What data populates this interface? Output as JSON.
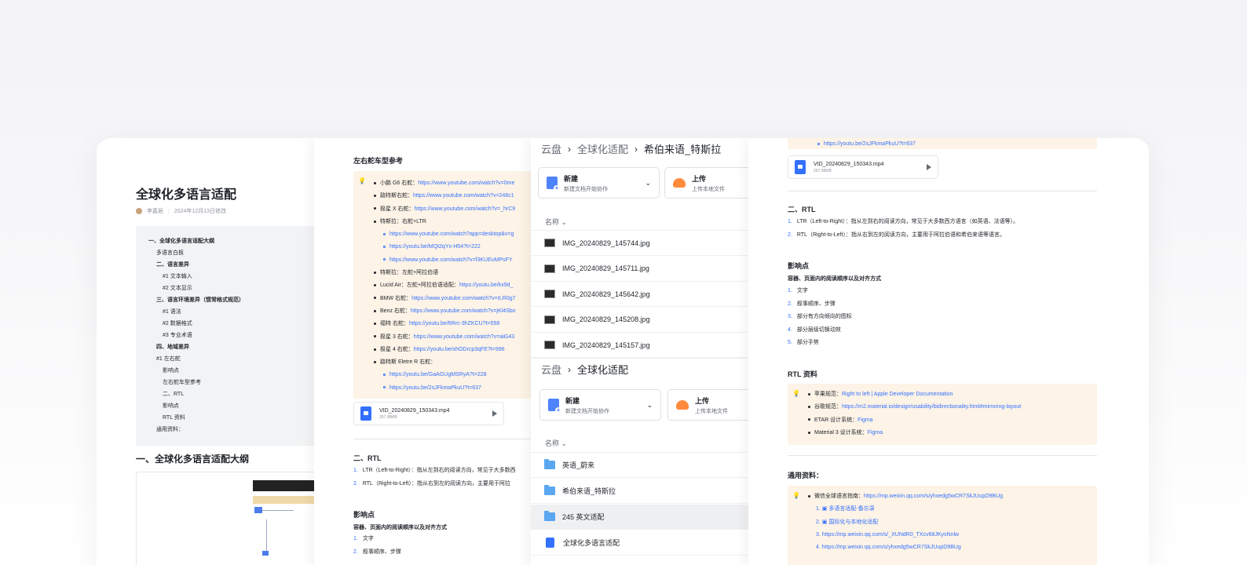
{
  "colors": {
    "accent": "#3370ff",
    "callout_bg": "#fdf3e6",
    "folder": "#5aa7f0"
  },
  "panel1": {
    "title": "全球化多语言适配",
    "author": "李嘉辰",
    "modified": "2024年12月13日修改",
    "outline": [
      {
        "text": "一、全球化多语言适配大纲",
        "level": 1,
        "bold": true
      },
      {
        "text": "多语言白板",
        "level": 2
      },
      {
        "text": "二、语言差异",
        "level": 2,
        "bold": true
      },
      {
        "text": "#1 文本输入",
        "level": 3
      },
      {
        "text": "#2 文本显示",
        "level": 3
      },
      {
        "text": "三、语言环境差异（惯常格式规范）",
        "level": 2,
        "bold": true
      },
      {
        "text": "#1 语法",
        "level": 3
      },
      {
        "text": "#2 数据格式",
        "level": 3
      },
      {
        "text": "#3 专业术语",
        "level": 3
      },
      {
        "text": "四、地域差异",
        "level": 2,
        "bold": true
      },
      {
        "text": "#1 左右舵",
        "level": 2
      },
      {
        "text": "影响点",
        "level": 3
      },
      {
        "text": "左右舵车型参考",
        "level": 3
      },
      {
        "text": "二、RTL",
        "level": 3
      },
      {
        "text": "影响点",
        "level": 3
      },
      {
        "text": "RTL 资料",
        "level": 3
      },
      {
        "text": "通用资料：",
        "level": 2
      }
    ],
    "heading": "一、全球化多语言适配大纲"
  },
  "panel2": {
    "section_title": "左右舵车型参考",
    "callout_items": [
      {
        "label": "小鹏 G6 右舵：",
        "link": "https://www.youtube.com/watch?v=0me",
        "level": 1
      },
      {
        "label": "路特斯右舵：",
        "link": "https://www.youtube.com/watch?v=248c1",
        "level": 1
      },
      {
        "label": "极星 X 右舵：",
        "link": "https://www.youtube.com/watch?v=_hrC9",
        "level": 1
      },
      {
        "label": "特斯拉：右舵+LTR",
        "link": "",
        "level": 1
      },
      {
        "label": "",
        "link": "https://www.youtube.com/watch?app=desktop&v=g",
        "level": 2
      },
      {
        "label": "",
        "link": "https://youtu.be/MQt2qYx-H54?t=222",
        "level": 2
      },
      {
        "label": "",
        "link": "https://www.youtube.com/watch?v=f3KUEuMPsFY",
        "level": 2
      },
      {
        "label": "特斯拉：左舵+阿拉伯语",
        "link": "",
        "level": 1
      },
      {
        "label": "Lucid Air：左舵+阿拉伯语适配：",
        "link": "https://youtu.be/kx9d_",
        "level": 1
      },
      {
        "label": "BMW 右舵：",
        "link": "https://www.youtube.com/watch?v=rLR0g7",
        "level": 1
      },
      {
        "label": "Benz 右舵：",
        "link": "https://www.youtube.com/watch?v=jKl4Sbo",
        "level": 1
      },
      {
        "label": "福特 右舵：",
        "link": "https://youtu.be/6Rrc-3hZKCU?t=558",
        "level": 1
      },
      {
        "label": "极星 3 右舵：",
        "link": "https://www.youtube.com/watch?v=aiG43",
        "level": 1
      },
      {
        "label": "极星 4 右舵：",
        "link": "https://youtu.be/xhODrcp3qFE?t=996",
        "level": 1
      },
      {
        "label": "路特斯 Eletre R 右舵：",
        "link": "",
        "level": 1
      },
      {
        "label": "",
        "link": "https://youtu.be/GaAGUgMSRyA?t=228",
        "level": 2
      },
      {
        "label": "",
        "link": "https://youtu.be/2sJFkmaPkuU?t=637",
        "level": 2
      }
    ],
    "file": {
      "name": "VID_20240829_150343.mp4",
      "size": "267.98MB"
    },
    "rtl_heading": "二、RTL",
    "rtl_items": [
      {
        "n": "1.",
        "text": "LTR（Left-to-Right）：指从左到右的阅读方向，常见于大多数西"
      },
      {
        "n": "2.",
        "text": "RTL（Right-to-Left）：指从右到左的阅读方向，主要用于阿拉"
      }
    ],
    "impact_heading": "影响点",
    "impact_sub": "容器、页面内的阅读顺序以及对齐方式",
    "impact_items": [
      {
        "n": "1.",
        "text": "文字"
      },
      {
        "n": "2.",
        "text": "叙事顺序、步骤"
      }
    ]
  },
  "panel3": {
    "crumbs_top": [
      "云盘",
      "全球化适配",
      "希伯来语_特斯拉"
    ],
    "crumbs_bottom": [
      "云盘",
      "全球化适配"
    ],
    "new_btn": {
      "title": "新建",
      "sub": "新建文档开始协作"
    },
    "upload_btn": {
      "title": "上传",
      "sub": "上传本地文件"
    },
    "col_name": "名称",
    "files": [
      "IMG_20240829_145744.jpg",
      "IMG_20240829_145711.jpg",
      "IMG_20240829_145642.jpg",
      "IMG_20240829_145208.jpg",
      "IMG_20240829_145157.jpg"
    ],
    "folders": [
      "英语_蔚来",
      "希伯来语_特斯拉",
      "245 英文适配"
    ],
    "doc": "全球化多语言适配"
  },
  "panel4": {
    "top_link": "https://youtu.be/2sJFkmaPkuU?t=637",
    "file": {
      "name": "VID_20240829_150343.mp4",
      "size": "267.98MB"
    },
    "rtl_heading": "二、RTL",
    "rtl_items": [
      {
        "n": "1.",
        "text": "LTR（Left-to-Right）：指从左到右的阅读方向，常见于大多数西方语言（如英语、法语等）。"
      },
      {
        "n": "2.",
        "text": "RTL（Right-to-Left）：指从右到左的阅读方向，主要用于阿拉伯语和希伯来语等语言。"
      }
    ],
    "impact_heading": "影响点",
    "impact_sub": "容器、页面内的阅读顺序以及对齐方式",
    "impact_items": [
      {
        "n": "1.",
        "text": "文字"
      },
      {
        "n": "2.",
        "text": "叙事顺序、步骤"
      },
      {
        "n": "3.",
        "text": "部分有方向倾向的图标"
      },
      {
        "n": "4.",
        "text": "部分层级切换动效"
      },
      {
        "n": "5.",
        "text": "部分手势"
      }
    ],
    "rtl_res_heading": "RTL 资料",
    "rtl_res": [
      {
        "label": "苹果规范：",
        "link": "Right to left | Apple Developer Documentation"
      },
      {
        "label": "谷歌规范：",
        "link": "https://m2.material.io/design/usability/bidirectionality.html#mirroring-layout"
      },
      {
        "label": "ETAR 设计系统：",
        "link": "Figma"
      },
      {
        "label": "Material 3 设计系统：",
        "link": "Figma"
      }
    ],
    "general_heading": "通用资料：",
    "general_lead": {
      "label": "微信全球语言指南：",
      "link": "https://mp.weixin.qq.com/s/yhxedg5wCR7SkJUupD9BUg"
    },
    "general_items": [
      {
        "n": "1.",
        "text": "多语言适配-备忘录"
      },
      {
        "n": "2.",
        "text": "国际化与本地化适配"
      },
      {
        "n": "3.",
        "text": "https://mp.weixin.qq.com/s/_XUNdR0_TXcv68JKysNnlw"
      },
      {
        "n": "4.",
        "text": "https://mp.weixin.qq.com/s/yhxedg5wCR7SkJUupD9BUg"
      }
    ]
  }
}
